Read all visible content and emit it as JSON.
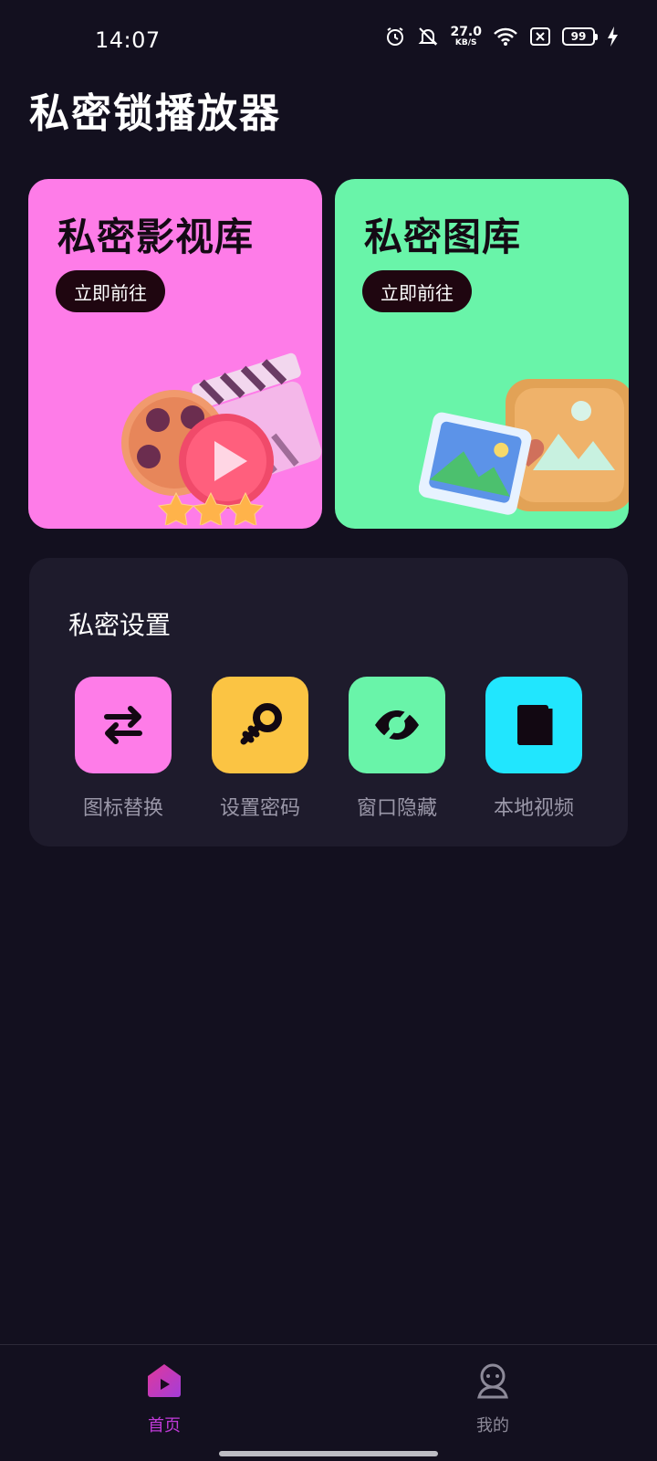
{
  "status_bar": {
    "time": "14:07",
    "net_speed_value": "27.0",
    "net_speed_unit": "KB/S",
    "battery": "99",
    "icons": [
      "alarm-icon",
      "bell-muted-icon",
      "wifi-icon",
      "sim-off-icon",
      "battery-icon",
      "charging-icon"
    ]
  },
  "app": {
    "title": "私密锁播放器"
  },
  "cards": [
    {
      "title": "私密影视库",
      "button_label": "立即前往",
      "color": "#fe7ce8",
      "illustration": "film-reel-play-icon"
    },
    {
      "title": "私密图库",
      "button_label": "立即前往",
      "color": "#69f4a9",
      "illustration": "photo-gallery-icon"
    }
  ],
  "settings": {
    "title": "私密设置",
    "items": [
      {
        "label": "图标替换",
        "icon": "swap-arrows-icon",
        "color": "#fe7ce8"
      },
      {
        "label": "设置密码",
        "icon": "key-icon",
        "color": "#fbc443"
      },
      {
        "label": "窗口隐藏",
        "icon": "eye-off-icon",
        "color": "#69f4a9"
      },
      {
        "label": "本地视频",
        "icon": "book-icon",
        "color": "#21e6fe"
      }
    ]
  },
  "bottom_nav": {
    "items": [
      {
        "label": "首页",
        "icon": "home-play-icon",
        "active": true,
        "color": "#c03ad8"
      },
      {
        "label": "我的",
        "icon": "profile-icon",
        "active": false,
        "color": "#8d8a99"
      }
    ]
  }
}
